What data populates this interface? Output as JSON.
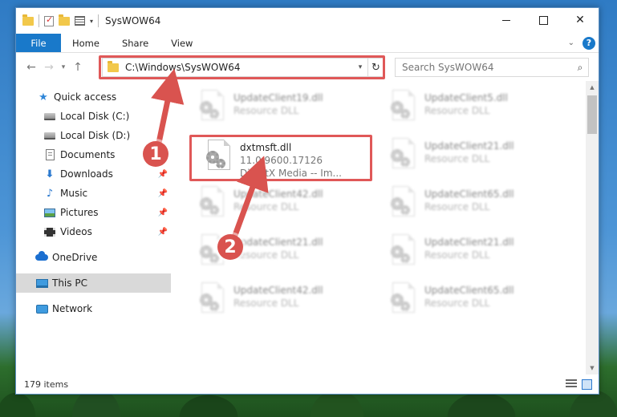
{
  "window": {
    "title": "SysWOW64"
  },
  "ribbon": {
    "tabs": [
      {
        "label": "File"
      },
      {
        "label": "Home"
      },
      {
        "label": "Share"
      },
      {
        "label": "View"
      }
    ],
    "help_label": "?"
  },
  "navbar": {
    "address": "C:\\Windows\\SysWOW64",
    "search_placeholder": "Search SysWOW64"
  },
  "sidebar": {
    "items": [
      {
        "label": "Quick access",
        "icon": "star-icon"
      },
      {
        "label": "Local Disk (C:)",
        "icon": "disk-icon"
      },
      {
        "label": "Local Disk (D:)",
        "icon": "disk-icon"
      },
      {
        "label": "Documents",
        "icon": "document-icon"
      },
      {
        "label": "Downloads",
        "icon": "download-icon"
      },
      {
        "label": "Music",
        "icon": "music-icon"
      },
      {
        "label": "Pictures",
        "icon": "pictures-icon"
      },
      {
        "label": "Videos",
        "icon": "videos-icon"
      },
      {
        "label": "OneDrive",
        "icon": "cloud-icon"
      },
      {
        "label": "This PC",
        "icon": "pc-icon"
      },
      {
        "label": "Network",
        "icon": "network-icon"
      }
    ]
  },
  "files": {
    "selected": {
      "name": "dxtmsft.dll",
      "version": "11.0.9600.17126",
      "description": "DirectX Media -- Im..."
    },
    "background": [
      {
        "name": "UpdateClient19.dll",
        "type": "Resource DLL"
      },
      {
        "name": "UpdateClient5.dll",
        "type": "Resource DLL"
      },
      {
        "name": "UpdateClient21.dll",
        "type": "Resource DLL"
      },
      {
        "name": "UpdateClient42.dll",
        "type": "Resource DLL"
      },
      {
        "name": "UpdateClient65.dll",
        "type": "Resource DLL"
      },
      {
        "name": "UpdateClient21.dll",
        "type": "Resource DLL"
      },
      {
        "name": "UpdateClient21.dll",
        "type": "Resource DLL"
      },
      {
        "name": "UpdateClient42.dll",
        "type": "Resource DLL"
      },
      {
        "name": "UpdateClient65.dll",
        "type": "Resource DLL"
      }
    ]
  },
  "statusbar": {
    "item_count": "179 items"
  },
  "annotations": {
    "step1": "1",
    "step2": "2",
    "highlight_color": "#e05858",
    "badge_color": "#d9534f"
  }
}
